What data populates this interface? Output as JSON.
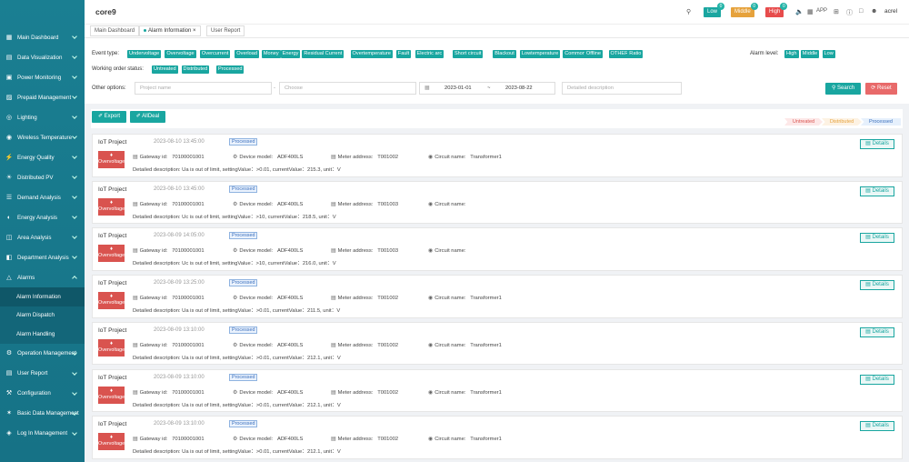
{
  "app": {
    "name": "core9"
  },
  "header": {
    "low_label": "Low",
    "low_count": "0",
    "middle_label": "Middle",
    "middle_count": "0",
    "high_label": "High",
    "high_count": "0",
    "app_label": "APP",
    "user": "acrel",
    "colors": {
      "low": "#1aa6a0",
      "middle": "#e6a23c",
      "high": "#e74c4c"
    }
  },
  "sidebar": {
    "items": [
      {
        "label": "Main Dashboard",
        "icon": "dashboard-icon"
      },
      {
        "label": "Data Visualization",
        "icon": "chart-icon"
      },
      {
        "label": "Power Monitoring",
        "icon": "monitor-icon"
      },
      {
        "label": "Prepaid Management",
        "icon": "wallet-icon"
      },
      {
        "label": "Lighting",
        "icon": "bulb-icon"
      },
      {
        "label": "Wireless Temperature",
        "icon": "thermometer-icon"
      },
      {
        "label": "Energy Quality",
        "icon": "lightning-icon"
      },
      {
        "label": "Distributed PV",
        "icon": "solar-icon"
      },
      {
        "label": "Demand Analysis",
        "icon": "analysis-icon"
      },
      {
        "label": "Energy Analysis",
        "icon": "energy-icon"
      },
      {
        "label": "Area Analysis",
        "icon": "area-icon"
      },
      {
        "label": "Department Analysis",
        "icon": "department-icon"
      },
      {
        "label": "Alarms",
        "icon": "bell-icon"
      }
    ],
    "alarm_sub": [
      "Alarm Information",
      "Alarm Dispatch",
      "Alarm Handling"
    ],
    "items_after": [
      {
        "label": "Operation Management",
        "icon": "operation-icon"
      },
      {
        "label": "User Report",
        "icon": "report-icon"
      },
      {
        "label": "Configuration",
        "icon": "config-icon"
      },
      {
        "label": "Basic Data Management",
        "icon": "data-icon"
      },
      {
        "label": "Log In Management",
        "icon": "login-icon"
      }
    ]
  },
  "tabs": [
    "Main Dashboard",
    "Alarm Information",
    "User Report"
  ],
  "filters": {
    "event_type_label": "Event type:",
    "event_types": [
      "Undervoltage",
      "Overvoltage",
      "Overcurrent",
      "Overload",
      "Money",
      "Energy",
      "Residual Current",
      "Overtemperature",
      "Fault",
      "Electric arc",
      "Short circuit",
      "Blackout",
      "Lowtemperature",
      "Common",
      "Offline",
      "OTHER",
      "Ratio"
    ],
    "alarm_level_label": "Alarm level:",
    "alarm_levels": [
      "High",
      "Middle",
      "Low"
    ],
    "order_status_label": "Working order status:",
    "order_statuses": [
      "Untreated",
      "Distributed",
      "Processed"
    ],
    "other_label": "Other options:",
    "project_placeholder": "Project name",
    "choose_placeholder": "Choose",
    "date_start": "2023-01-01",
    "date_sep": "~",
    "date_end": "2023-08-22",
    "desc_placeholder": "Detailed description",
    "search_label": "Search",
    "reset_label": "Reset"
  },
  "actions": {
    "export_label": "Export",
    "alldeal_label": "AllDeal"
  },
  "status_legend": [
    "Untreated",
    "Distributed",
    "Processed"
  ],
  "records": [
    {
      "project": "IoT Project",
      "time": "2023-08-10 13:45:00",
      "status": "Processed",
      "type": "Overvoltage",
      "gateway": "70100001001",
      "model": "ADF400LS",
      "meter": "T001002",
      "circuit": "Transformer1",
      "desc": "Detailed description: Ua is out of limit,  settingValue：>0.01,  currentValue：215.3,  unit：V"
    },
    {
      "project": "IoT Project",
      "time": "2023-08-10 13:45:00",
      "status": "Processed",
      "type": "Overvoltage",
      "gateway": "70100001001",
      "model": "ADF400LS",
      "meter": "T001003",
      "circuit": "",
      "desc": "Detailed description: Uc is out of limit,  settingValue：>10,  currentValue：218.5,  unit：V"
    },
    {
      "project": "IoT Project",
      "time": "2023-08-09 14:05:00",
      "status": "Processed",
      "type": "Overvoltage",
      "gateway": "70100001001",
      "model": "ADF400LS",
      "meter": "T001003",
      "circuit": "",
      "desc": "Detailed description: Uc is out of limit,  settingValue：>10,  currentValue：216.0,  unit：V"
    },
    {
      "project": "IoT Project",
      "time": "2023-08-09 13:25:00",
      "status": "Processed",
      "type": "Overvoltage",
      "gateway": "70100001001",
      "model": "ADF400LS",
      "meter": "T001002",
      "circuit": "Transformer1",
      "desc": "Detailed description: Ua is out of limit,  settingValue：>0.01,  currentValue：211.5,  unit：V"
    },
    {
      "project": "IoT Project",
      "time": "2023-08-09 13:10:00",
      "status": "Processed",
      "type": "Overvoltage",
      "gateway": "70100001001",
      "model": "ADF400LS",
      "meter": "T001002",
      "circuit": "Transformer1",
      "desc": "Detailed description: Ua is out of limit,  settingValue：>0.01,  currentValue：212.1,  unit：V"
    },
    {
      "project": "IoT Project",
      "time": "2023-08-09 13:10:00",
      "status": "Processed",
      "type": "Overvoltage",
      "gateway": "70100001001",
      "model": "ADF400LS",
      "meter": "T001002",
      "circuit": "Transformer1",
      "desc": "Detailed description: Ua is out of limit,  settingValue：>0.01,  currentValue：212.1,  unit：V"
    },
    {
      "project": "IoT Project",
      "time": "2023-08-09 13:10:00",
      "status": "Processed",
      "type": "Overvoltage",
      "gateway": "70100001001",
      "model": "ADF400LS",
      "meter": "T001002",
      "circuit": "Transformer1",
      "desc": "Detailed description: Ua is out of limit,  settingValue：>0.01,  currentValue：212.1,  unit：V"
    }
  ],
  "record_labels": {
    "gateway": "Gateway id:",
    "model": "Device model:",
    "meter": "Meter address:",
    "circuit": "Circuit name:",
    "details": "Details"
  }
}
